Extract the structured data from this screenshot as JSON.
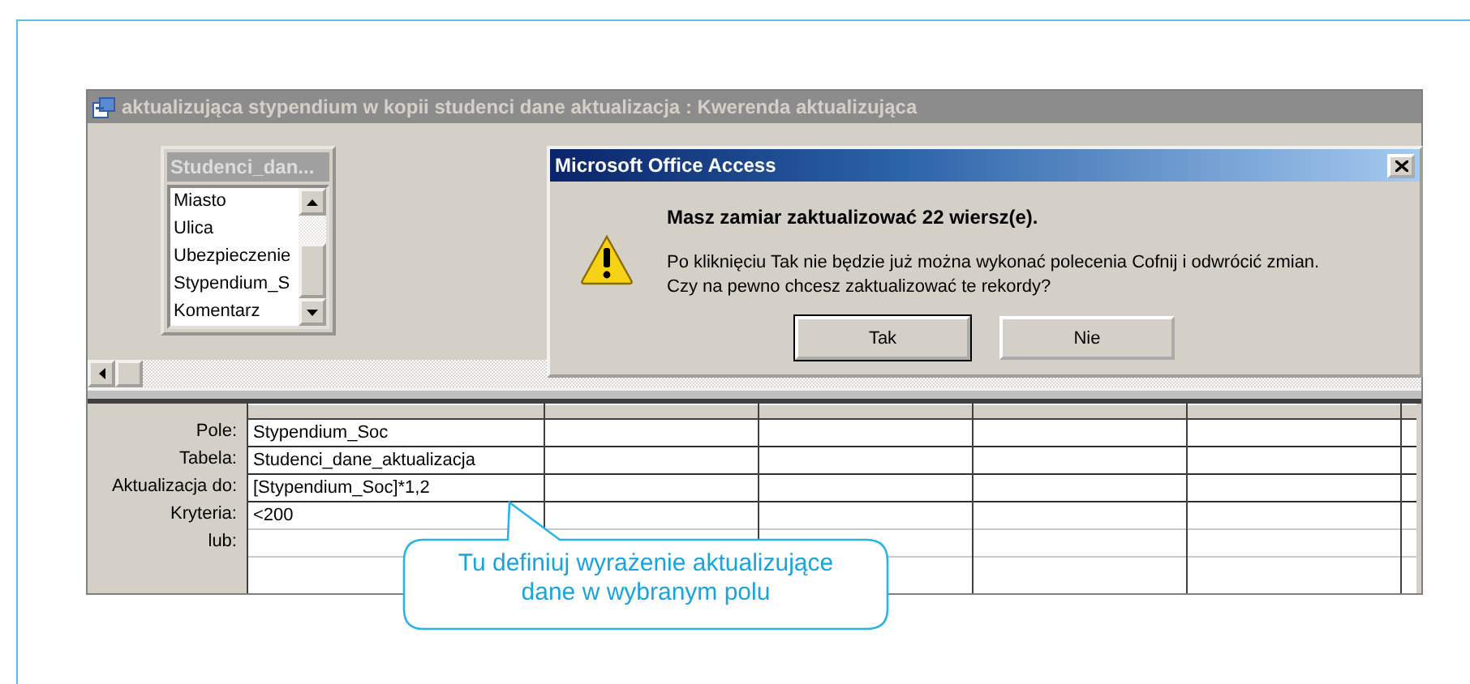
{
  "window": {
    "title": "aktualizująca stypendium w kopii studenci dane aktualizacja : Kwerenda aktualizująca"
  },
  "table_box": {
    "title": "Studenci_dan...",
    "fields": [
      "Miasto",
      "Ulica",
      "Ubezpieczenie",
      "Stypendium_S",
      "Komentarz"
    ]
  },
  "dialog": {
    "title": "Microsoft Office Access",
    "heading": "Masz zamiar zaktualizować 22 wiersz(e).",
    "message": "Po kliknięciu Tak nie będzie już można wykonać polecenia Cofnij i odwrócić zmian.\nCzy na pewno chcesz zaktualizować te rekordy?",
    "buttons": [
      {
        "label": "Tak",
        "default": true
      },
      {
        "label": "Nie",
        "default": false
      }
    ]
  },
  "grid": {
    "rows": [
      {
        "label": "Pole:",
        "cells": [
          "Stypendium_Soc"
        ]
      },
      {
        "label": "Tabela:",
        "cells": [
          "Studenci_dane_aktualizacja"
        ]
      },
      {
        "label": "Aktualizacja do:",
        "cells": [
          "[Stypendium_Soc]*1,2"
        ]
      },
      {
        "label": "Kryteria:",
        "cells": [
          "<200"
        ]
      },
      {
        "label": "lub:",
        "cells": []
      }
    ]
  },
  "callout": {
    "text": "Tu definiuj wyrażenie aktualizujące\ndane w wybranym polu"
  }
}
